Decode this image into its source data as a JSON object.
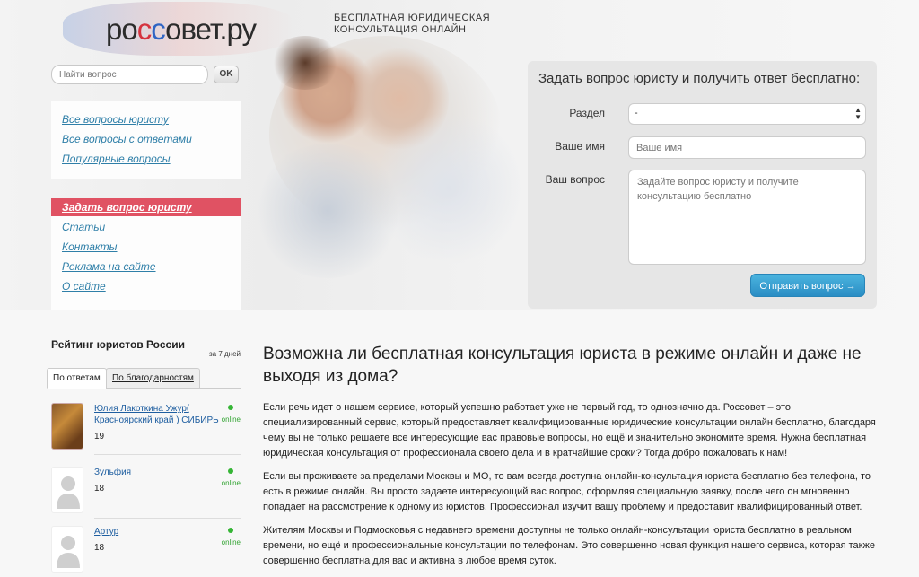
{
  "header": {
    "logo_part1": "ро",
    "logo_part2": "с",
    "logo_part3": "с",
    "logo_part4": "овет.ру",
    "slogan_line1": "БЕСПЛАТНАЯ ЮРИДИЧЕСКАЯ",
    "slogan_line2": "КОНСУЛЬТАЦИЯ ОНЛАЙН"
  },
  "search": {
    "placeholder": "Найти вопрос",
    "button_label": "OK"
  },
  "nav_top": [
    {
      "label": "Все вопросы юристу"
    },
    {
      "label": "Все вопросы с ответами"
    },
    {
      "label": "Популярные вопросы"
    }
  ],
  "nav_bottom": [
    {
      "label": "Задать вопрос юристу",
      "active": true
    },
    {
      "label": "Статьи"
    },
    {
      "label": "Контакты"
    },
    {
      "label": "Реклама на сайте"
    },
    {
      "label": "О сайте"
    }
  ],
  "form": {
    "title": "Задать вопрос юристу и получить ответ бесплатно:",
    "section_label": "Раздел",
    "section_value": "-",
    "name_label": "Ваше имя",
    "name_placeholder": "Ваше имя",
    "question_label": "Ваш вопрос",
    "question_placeholder": "Задайте вопрос юристу и получите консультацию бесплатно",
    "submit_label": "Отправить вопрос →"
  },
  "rating": {
    "title": "Рейтинг юристов России",
    "period": "за 7 дней",
    "tab1": "По ответам",
    "tab2": "По благодарностям",
    "lawyers": [
      {
        "name": "Юлия Лакоткина Ужур( Красноярский край ) СИБИРЬ",
        "score": "19",
        "status": "online"
      },
      {
        "name": "Зульфия",
        "score": "18",
        "status": "online"
      },
      {
        "name": "Артур",
        "score": "18",
        "status": "online"
      }
    ]
  },
  "article": {
    "heading": "Возможна ли бесплатная консультация юриста в режиме онлайн и даже не выходя из дома?",
    "p1": "Если речь идет о нашем сервисе, который успешно работает уже не первый год, то однозначно да. Россовет – это специализированный сервис, который предоставляет квалифицированные юридические консультации онлайн бесплатно, благодаря чему вы не только решаете все интересующие вас правовые вопросы, но ещё и значительно экономите время. Нужна бесплатная юридическая консультация от профессионала своего дела и в кратчайшие сроки? Тогда добро пожаловать к нам!",
    "p2": "Если вы проживаете за пределами Москвы и МО, то вам всегда доступна онлайн-консультация юриста бесплатно без телефона, то есть в режиме онлайн. Вы просто задаете интересующий вас вопрос, оформляя специальную заявку, после чего он мгновенно попадает на рассмотрение к одному из юристов. Профессионал изучит вашу проблему и предоставит квалифицированный ответ.",
    "p3": "Жителям Москвы и Подмосковья с недавнего времени доступны не только онлайн-консультации юриста бесплатно в реальном времени, но ещё и профессиональные консультации по телефонам. Это совершенно новая функция нашего сервиса, которая также совершенно бесплатна для вас и активна в любое время суток."
  }
}
